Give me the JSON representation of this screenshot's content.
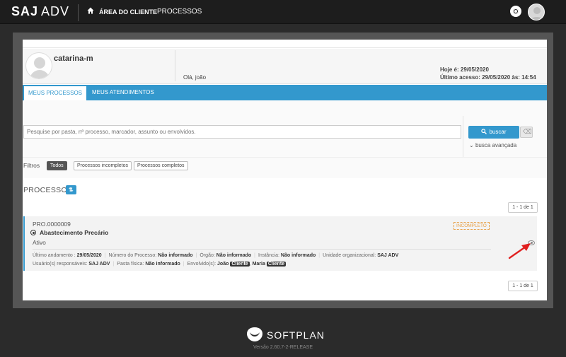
{
  "topbar": {
    "logo_main": "SAJ",
    "logo_sub": "ADV",
    "area_label": "ÁREA DO CLIENTE",
    "section_label": "PROCESSOS"
  },
  "profile": {
    "username": "catarina-m",
    "greeting": "Olá, joão",
    "today": "Hoje é: 29/05/2020",
    "last_access": "Último acesso: 29/05/2020 às: 14:54"
  },
  "tabs": [
    {
      "label": "MEUS PROCESSOS",
      "active": true
    },
    {
      "label": "MEUS ATENDIMENTOS",
      "active": false
    }
  ],
  "search": {
    "placeholder": "Pesquise por pasta, nº processo, marcador, assunto ou envolvidos.",
    "button_label": "buscar",
    "advanced_label": "busca avançada"
  },
  "filters": {
    "label": "Filtros",
    "options": [
      "Todos",
      "Processos incompletos",
      "Processos completos"
    ]
  },
  "processes": {
    "title": "PROCESSOS",
    "sort_symbol": "⇅",
    "pager_top": "1 - 1 de 1",
    "pager_bottom": "1 - 1 de 1",
    "items": [
      {
        "number": "PRO.0000009",
        "name": "Abastecimento Precário",
        "status": "Ativo",
        "badge": "INCOMPLETO",
        "last_update_label": "Último andamento :",
        "last_update": "29/05/2020",
        "proc_number_label": "Número do Processo:",
        "proc_number": "Não informado",
        "organ_label": "Órgão:",
        "organ": "Não informado",
        "instance_label": "Instância:",
        "instance": "Não informado",
        "unit_label": "Unidade organizacional:",
        "unit": "SAJ ADV",
        "responsible_label": "Usuário(s) responsáveis:",
        "responsible": "SAJ ADV",
        "folder_label": "Pasta física:",
        "folder": "Não informado",
        "involved_label": "Envolvido(s):",
        "involved_1": "João",
        "involved_1_tag": "Cliente",
        "involved_2": "Maria",
        "involved_2_tag": "Cliente"
      }
    ]
  },
  "footer": {
    "brand": "SOFTPLAN",
    "version": "Versão 2.60.7-2-RELEASE"
  },
  "colors": {
    "accent": "#3398cd",
    "badge": "#e8a24a",
    "arrow": "#e02020"
  }
}
